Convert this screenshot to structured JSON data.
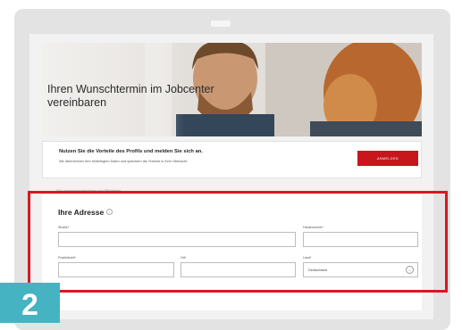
{
  "hero": {
    "title_line1": "Ihren Wunschtermin im Jobcenter",
    "title_line2": "vereinbaren"
  },
  "login": {
    "headline": "Nutzen Sie die Vorteile des Profils und melden Sie sich an.",
    "subtext": "Wir übernehmen Ihre hinterlegten Daten und speichern die Termine in Ihrer Übersicht.",
    "button_label": "ANMELDEN"
  },
  "required_note": "Mit * gekennzeichnete Felder sind Pflichtfelder",
  "address": {
    "title": "Ihre Adresse",
    "info_icon": "info-circle-icon",
    "street_label": "Straße*",
    "street_value": "",
    "housenumber_label": "Hausnummer*",
    "housenumber_value": "",
    "postcode_label": "Postleitzahl*",
    "postcode_value": "",
    "city_label": "Ort*",
    "city_value": "",
    "country_label": "Land*",
    "country_value": "Deutschland"
  },
  "step_badge": "2",
  "colors": {
    "accent_red": "#c8161d",
    "highlight_red": "#d81920",
    "badge_teal": "#45b3c2"
  }
}
